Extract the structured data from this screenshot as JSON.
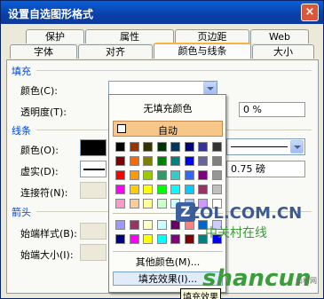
{
  "window": {
    "title": "设置自选图形格式",
    "close": "×"
  },
  "tabs_back": [
    "保护",
    "属性",
    "页边距",
    "Web"
  ],
  "tabs_front": [
    "字体",
    "对齐",
    "颜色与线条",
    "大小"
  ],
  "fill": {
    "group": "填充",
    "color_label": "颜色(C):",
    "transparency_label": "透明度(T):",
    "transparency_value": "0 %"
  },
  "line": {
    "group": "线条",
    "color_label": "颜色(O):",
    "dash_label": "虚实(D):",
    "dash_value": "0.75 磅",
    "connector_label": "连接符(N):"
  },
  "arrows": {
    "group": "箭头",
    "start_style_label": "始端样式(B):",
    "start_size_label": "始端大小(I):"
  },
  "popup": {
    "no_fill": "无填充颜色",
    "auto": "自动",
    "more_colors": "其他颜色(M)...",
    "fill_effects": "填充效果(I)...",
    "tooltip": "填充效果",
    "colors": [
      [
        "#000000",
        "#993300",
        "#333300",
        "#003300",
        "#003366",
        "#000080",
        "#333399",
        "#333333"
      ],
      [
        "#800000",
        "#ff6600",
        "#808000",
        "#008000",
        "#008080",
        "#0000ff",
        "#666699",
        "#808080"
      ],
      [
        "#ff0000",
        "#ff9900",
        "#99cc00",
        "#339966",
        "#33cccc",
        "#3366ff",
        "#800080",
        "#969696"
      ],
      [
        "#ff00ff",
        "#ffcc00",
        "#ffff00",
        "#00ff00",
        "#00ffff",
        "#00ccff",
        "#993366",
        "#c0c0c0"
      ],
      [
        "#ff99cc",
        "#ffcc99",
        "#ffff99",
        "#ccffcc",
        "#ccffff",
        "#99ccff",
        "#cc99ff",
        "#ffffff"
      ]
    ],
    "colors2": [
      [
        "#9999ff",
        "#993366",
        "#ffffcc",
        "#ccffff",
        "#660066",
        "#ff8080",
        "#0066cc",
        "#ccccff"
      ],
      [
        "#000080",
        "#ff00ff",
        "#ffff00",
        "#00ffff",
        "#800080",
        "#800000",
        "#008080",
        "#0000ff"
      ]
    ]
  },
  "watermark": {
    "zol": "ZOL.COM.CN",
    "zol_cn": "中关村在线",
    "z": "Z",
    "shancun": "shancun",
    "shancun_small": "山村网"
  }
}
